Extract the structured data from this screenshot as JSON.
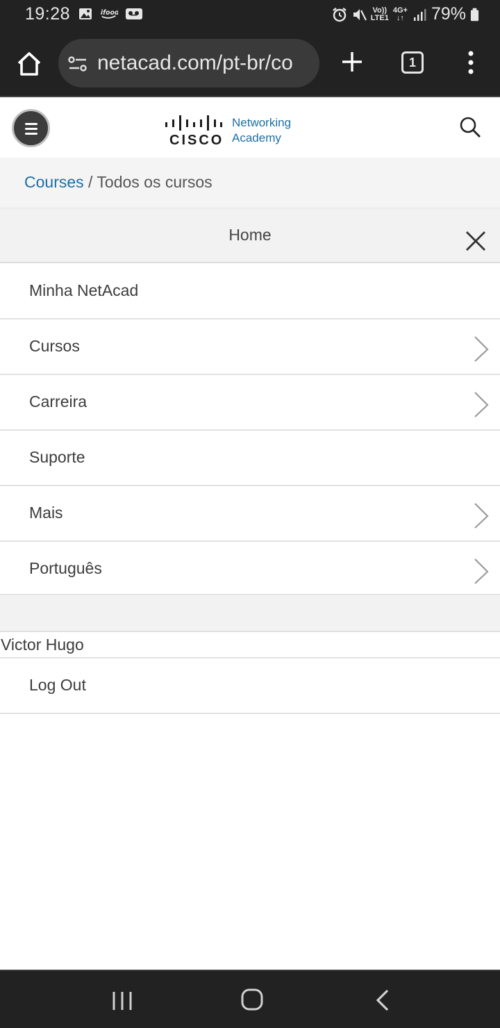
{
  "status_bar": {
    "time": "19:28",
    "left_icons": [
      "image-icon",
      "ifood-icon",
      "voicemail-icon"
    ],
    "network": [
      "Vo))",
      "LTE1"
    ],
    "network_type": "4G+",
    "battery": "79%"
  },
  "browser": {
    "url": "netacad.com/pt-br/co",
    "tab_count": "1"
  },
  "header": {
    "logo_brand": "CISCO",
    "logo_line1": "Networking",
    "logo_line2": "Academy"
  },
  "breadcrumb": {
    "link": "Courses",
    "separator": " / ",
    "current": "Todos os cursos"
  },
  "menu": {
    "title": "Home",
    "items": [
      {
        "label": "Minha NetAcad",
        "has_submenu": false
      },
      {
        "label": "Cursos",
        "has_submenu": true
      },
      {
        "label": "Carreira",
        "has_submenu": true
      },
      {
        "label": "Suporte",
        "has_submenu": false
      },
      {
        "label": "Mais",
        "has_submenu": true
      },
      {
        "label": "Português",
        "has_submenu": true
      }
    ],
    "user_name": "Victor Hugo",
    "logout_label": "Log Out"
  },
  "colors": {
    "system_bar": "#222222",
    "brand_blue": "#1d6fa3"
  }
}
